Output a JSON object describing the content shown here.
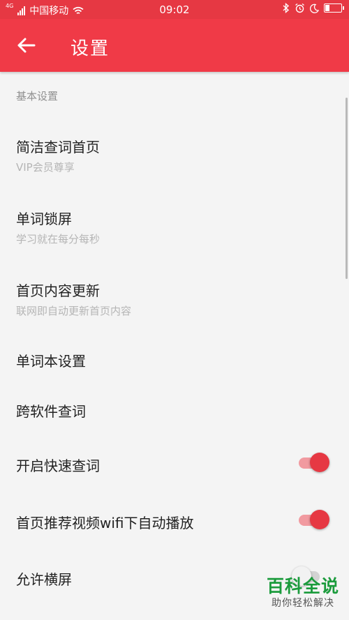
{
  "status_bar": {
    "carrier": "中国移动",
    "network_type": "4G",
    "time": "09:02",
    "icons": [
      "signal-icon",
      "wifi-icon",
      "bluetooth-icon",
      "alarm-icon",
      "moon-icon",
      "battery-icon"
    ],
    "battery_level": 0.3
  },
  "app_bar": {
    "title": "设置",
    "back_icon": "arrow-left-icon",
    "color": "#f03a47"
  },
  "sections": [
    {
      "label": "基本设置"
    }
  ],
  "settings": [
    {
      "title": "简洁查词首页",
      "subtitle": "VIP会员尊享"
    },
    {
      "title": "单词锁屏",
      "subtitle": "学习就在每分每秒"
    },
    {
      "title": "首页内容更新",
      "subtitle": "联网即自动更新首页内容"
    },
    {
      "title": "单词本设置"
    },
    {
      "title": "跨软件查词"
    },
    {
      "title": "开启快速查词",
      "toggle": true
    },
    {
      "title": "首页推荐视频wifi下自动播放",
      "toggle": true
    },
    {
      "title": "允许横屏",
      "toggle": false
    }
  ],
  "watermark": {
    "title": "百科全说",
    "subtitle": "助你轻松解决"
  },
  "colors": {
    "accent": "#e63843",
    "toggle_track_on": "#f19aa0",
    "background": "#f4f4f4"
  }
}
